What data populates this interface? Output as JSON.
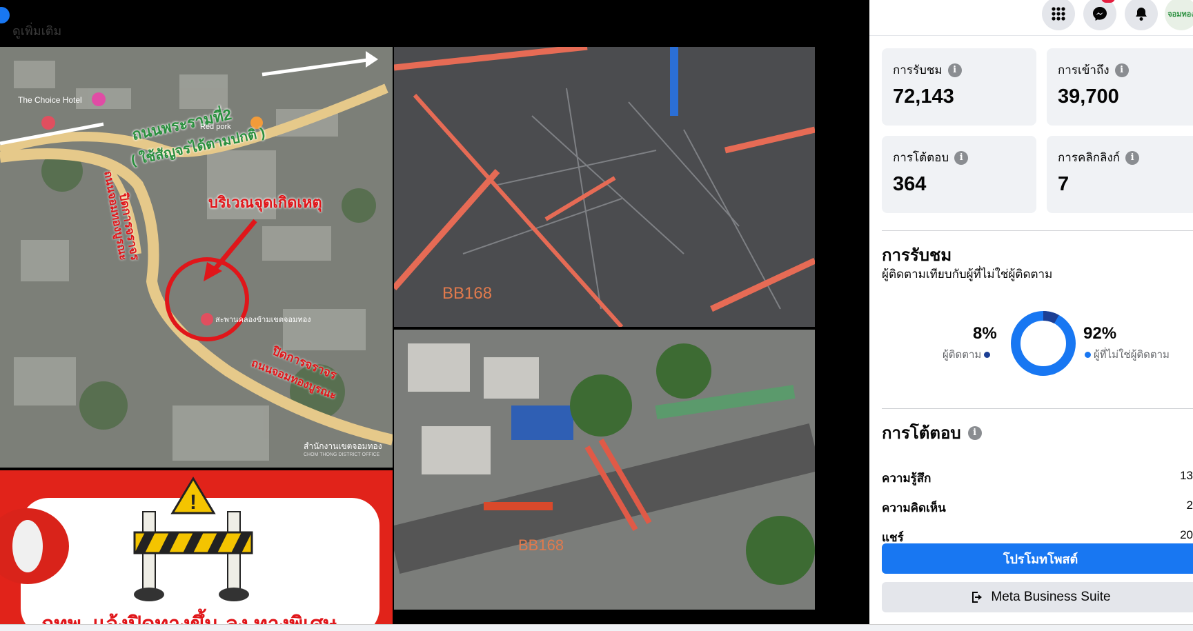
{
  "media": {
    "top_text": "ดูเพิ่มเติม",
    "map": {
      "road_name": "ถนนพระรามที่2",
      "road_note": "( ใช้สัญจรได้ตามปกติ )",
      "accident_label": "บริเวณจุดเกิดเหตุ",
      "hotel": "The Choice Hotel",
      "red_pork": "Red pork",
      "closed_1": "ปิดการจราจร",
      "closed_2": "ปิดการจราจร",
      "road_v": "ถนนจอมทองบูรณะ",
      "road_d": "ถนนจอมทองบูรณะ",
      "district_office": "สำนักงานเขตจอมทอง",
      "district_office_en": "CHOM THONG DISTRICT OFFICE",
      "marker": "สะพานคลองข้ามเขตจอมทอง"
    },
    "photo_label_1": "BB168",
    "photo_label_2": "BB168",
    "notice_title": "กทพ. แจ้งปิดทางขึ้น-ลง ทางพิเศษ"
  },
  "topbar": {
    "icons": [
      "grid-menu-icon",
      "messenger-icon",
      "notifications-icon",
      "profile-avatar"
    ],
    "avatar_text": "จอมทอง"
  },
  "stats": [
    {
      "label": "การรับชม",
      "value": "72,143"
    },
    {
      "label": "การเข้าถึง",
      "value": "39,700"
    },
    {
      "label": "การโต้ตอบ",
      "value": "364"
    },
    {
      "label": "การคลิกลิงก์",
      "value": "7"
    }
  ],
  "views_section": {
    "title": "การรับชม",
    "subtitle": "ผู้ติดตามเทียบกับผู้ที่ไม่ใช่ผู้ติดตาม",
    "followers_pct": "8%",
    "followers_label": "ผู้ติดตาม",
    "non_followers_pct": "92%",
    "non_followers_label": "ผู้ที่ไม่ใช่ผู้ติดตาม",
    "followers_fraction": 0.08,
    "colors": {
      "followers": "#1c3f94",
      "non_followers": "#1877f2"
    }
  },
  "engagement_section": {
    "title": "การโต้ตอบ",
    "rows": [
      {
        "label": "ความรู้สึก",
        "value": "13"
      },
      {
        "label": "ความคิดเห็น",
        "value": "2"
      },
      {
        "label": "แชร์",
        "value": "20"
      }
    ]
  },
  "buttons": {
    "promote": "โปรโมทโพสต์",
    "business_suite": "Meta Business Suite"
  }
}
